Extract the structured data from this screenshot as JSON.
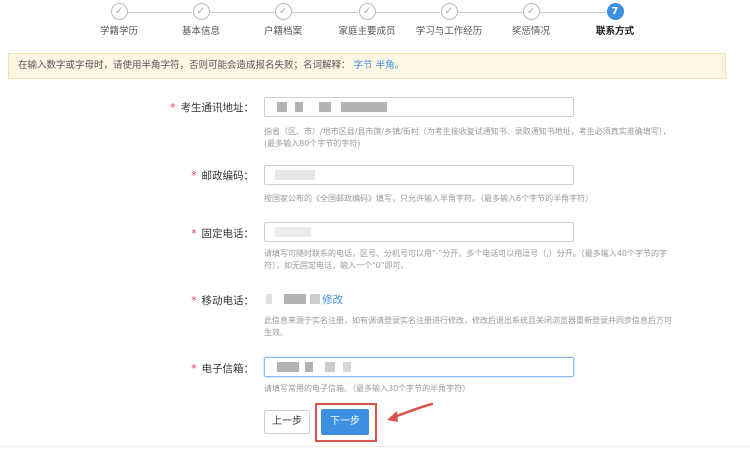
{
  "steps": [
    {
      "label": "学籍学历",
      "state": "done"
    },
    {
      "label": "基本信息",
      "state": "done"
    },
    {
      "label": "户籍档案",
      "state": "done"
    },
    {
      "label": "家庭主要成员",
      "state": "done"
    },
    {
      "label": "学习与工作经历",
      "state": "done"
    },
    {
      "label": "奖惩情况",
      "state": "done"
    },
    {
      "label": "联系方式",
      "state": "active",
      "number": "7"
    }
  ],
  "notice": {
    "text": "在输入数字或字母时，请使用半角字符，否则可能会造成报名失败；名词解释：",
    "links": "字节 半角。"
  },
  "form": {
    "address": {
      "label": "考生通讯地址：",
      "required": "*",
      "hint1": "指省（区、市）/地市区县/县市旗/乡镇/街村（为考生接收复试通知书、录取通知书地址，考生必须真实准确填写），",
      "hint2": "(最多输入80个字节的字符)"
    },
    "postcode": {
      "label": "邮政编码：",
      "required": "*",
      "hint": "按国家公布的《全国邮政编码》填写，只允许输入半角字符。（最多输入6个字节的半角字符）"
    },
    "phone": {
      "label": "固定电话：",
      "required": "*",
      "hint1": "请填写可随时联系的电话，区号、分机号可以用\"-\"分开，多个电话可以用逗号（,）分开。（最多输入40个字节的字",
      "hint2": "符），如无固定电话，输入一个\"0\"即可。"
    },
    "mobile": {
      "label": "移动电话：",
      "required": "*",
      "edit": "修改",
      "hint1": "此信息来源于实名注册，如有调请登录实名注册进行修改，修改后退出系统且关闭浏览器重新登录并同步信息后方可",
      "hint2": "生效。"
    },
    "email": {
      "label": "电子信箱：",
      "required": "*",
      "hint": "请填写常用的电子信箱。（最多输入30个字节的半角字符）"
    }
  },
  "buttons": {
    "prev": "上一步",
    "next": "下一步"
  },
  "colors": {
    "accent": "#3d8fe0",
    "highlight_frame": "#d9534f",
    "required_mark": "#e04040",
    "notice_bg": "#fdf6e3"
  }
}
